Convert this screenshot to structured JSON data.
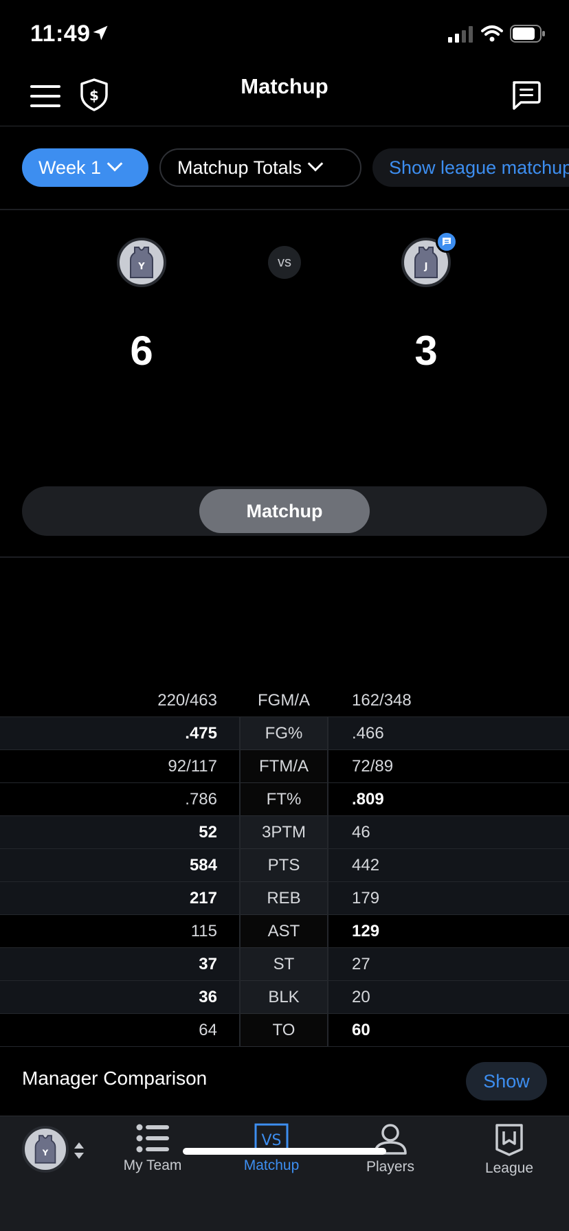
{
  "status_bar": {
    "time": "11:49"
  },
  "header": {
    "title": "Matchup"
  },
  "filters": {
    "week": "Week 1",
    "totals": "Matchup Totals",
    "league": "Show league matchups"
  },
  "scoreboard": {
    "left_initial": "Y",
    "right_initial": "J",
    "vs": "vs",
    "left_score": "6",
    "right_score": "3",
    "segment_label": "Matchup"
  },
  "stats": [
    {
      "left": "220/463",
      "cat": "FGM/A",
      "right": "162/348",
      "winner": "none"
    },
    {
      "left": ".475",
      "cat": "FG%",
      "right": ".466",
      "winner": "left"
    },
    {
      "left": "92/117",
      "cat": "FTM/A",
      "right": "72/89",
      "winner": "none"
    },
    {
      "left": ".786",
      "cat": "FT%",
      "right": ".809",
      "winner": "right"
    },
    {
      "left": "52",
      "cat": "3PTM",
      "right": "46",
      "winner": "left"
    },
    {
      "left": "584",
      "cat": "PTS",
      "right": "442",
      "winner": "left"
    },
    {
      "left": "217",
      "cat": "REB",
      "right": "179",
      "winner": "left"
    },
    {
      "left": "115",
      "cat": "AST",
      "right": "129",
      "winner": "right"
    },
    {
      "left": "37",
      "cat": "ST",
      "right": "27",
      "winner": "left"
    },
    {
      "left": "36",
      "cat": "BLK",
      "right": "20",
      "winner": "left"
    },
    {
      "left": "64",
      "cat": "TO",
      "right": "60",
      "winner": "right"
    }
  ],
  "manager": {
    "label": "Manager Comparison",
    "show": "Show"
  },
  "nav": {
    "team_initial": "Y",
    "items": [
      {
        "label": "My Team",
        "icon": "list-icon"
      },
      {
        "label": "Matchup",
        "icon": "vs-icon",
        "active": true
      },
      {
        "label": "Players",
        "icon": "person-icon"
      },
      {
        "label": "League",
        "icon": "bookmark-icon"
      }
    ]
  },
  "colors": {
    "accent": "#3d8ef0",
    "background": "#000000",
    "nav_bg": "#1a1c20"
  }
}
